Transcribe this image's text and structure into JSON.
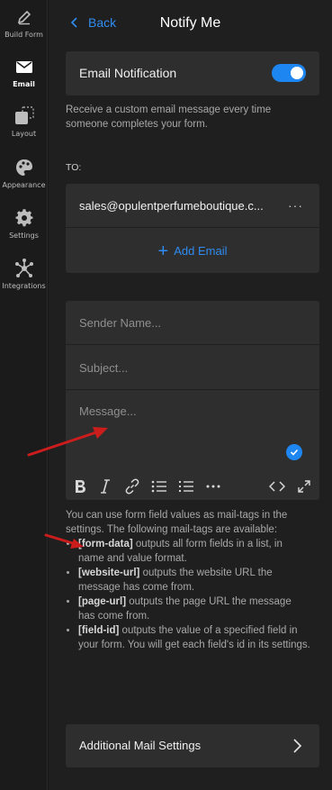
{
  "rail": {
    "items": [
      {
        "label": "Build Form",
        "icon": "pencil-icon"
      },
      {
        "label": "Email",
        "icon": "envelope-icon",
        "active": true
      },
      {
        "label": "Layout",
        "icon": "layout-icon"
      },
      {
        "label": "Appearance",
        "icon": "palette-icon"
      },
      {
        "label": "Settings",
        "icon": "gear-icon"
      },
      {
        "label": "Integrations",
        "icon": "integrations-icon"
      }
    ]
  },
  "header": {
    "back_label": "Back",
    "title": "Notify Me"
  },
  "email_notification": {
    "label": "Email Notification",
    "enabled": true,
    "help_text": "Receive a custom email message every time someone completes your form."
  },
  "recipients": {
    "to_label": "TO:",
    "emails": [
      "sales@opulentperfumeboutique.c..."
    ],
    "more_label": "···",
    "add_label": "Add Email"
  },
  "compose": {
    "sender_placeholder": "Sender Name...",
    "subject_placeholder": "Subject...",
    "message_placeholder": "Message..."
  },
  "mail_tags": {
    "intro": "You can use form field values as mail-tags in the settings. The following mail-tags are available:",
    "items": [
      {
        "tag": "[form-data]",
        "desc": " outputs all form fields in a list, in name and value format."
      },
      {
        "tag": "[website-url]",
        "desc": " outputs the website URL the message has come from."
      },
      {
        "tag": "[page-url]",
        "desc": " outputs the page URL the message has come from."
      },
      {
        "tag": "[field-id]",
        "desc": " outputs the value of a specified field in your form. You will get each field's id in its settings."
      }
    ]
  },
  "additional": {
    "label": "Additional Mail Settings"
  },
  "colors": {
    "accent": "#1e86f0",
    "link": "#2f8cf0",
    "annotation_arrow": "#cc1d1d"
  }
}
